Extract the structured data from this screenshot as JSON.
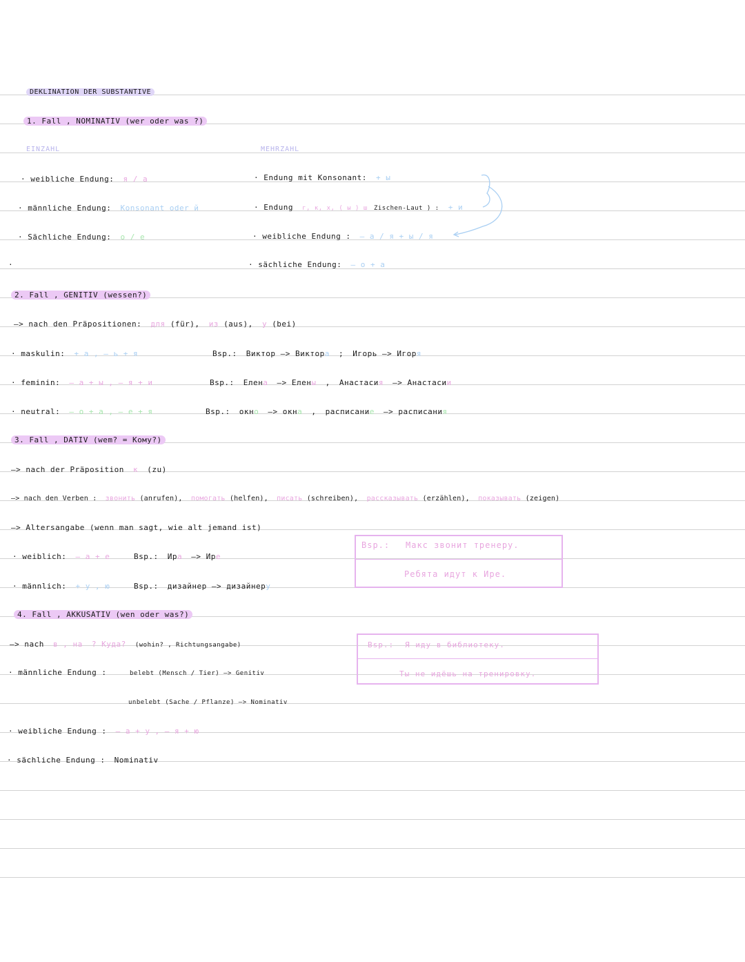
{
  "title": "DEKLINATION DER SUBSTANTIVE",
  "nominativ": {
    "heading": "1. Fall , NOMINATIV (wer oder was ?)",
    "einzahl_label": "EINZAHL",
    "mehrzahl_label": "MEHRZAHL",
    "sg_weiblich": "· weibliche Endung:",
    "sg_weiblich_val": "я / а",
    "sg_maennlich": "· männliche Endung:",
    "sg_maennlich_val": "Konsonant oder й",
    "sg_saechlich": "· Sächliche Endung:",
    "sg_saechlich_val": "о / е",
    "dot": "·",
    "pl_konsonant": "· Endung mit Konsonant:",
    "pl_konsonant_val": "+ ы",
    "pl_endung": "· Endung",
    "pl_endung_val": "г, к, х, ( ы ) ш",
    "pl_endung_note": "Zischen-Laut ) :",
    "pl_endung_val2": "+ и",
    "pl_weiblich": "· weibliche Endung :",
    "pl_weiblich_val": "– а / я + ы / я",
    "pl_saechlich": "· sächliche Endung:",
    "pl_saechlich_val": "– о + а"
  },
  "genitiv": {
    "heading": "2. Fall , GENITIV (wessen?)",
    "praep_label": "–> nach den Präpositionen:",
    "praep1": "для",
    "praep1_de": "(für),",
    "praep2": "из",
    "praep2_de": "(aus),",
    "praep3": "у",
    "praep3_de": "(bei)",
    "mask_label": "· maskulin:",
    "mask_val": "+ а , – ь + я",
    "mask_bsp": "Bsp.:",
    "mask_ex1a": "Виктор –> Виктор",
    "mask_ex1b": "а",
    "mask_semi": ";",
    "mask_ex2a": "Игорь –> Игор",
    "mask_ex2b": "я",
    "fem_label": "· feminin:",
    "fem_val": "– а + ы , – я + и",
    "fem_bsp": "Bsp.:",
    "fem_ex1a": "Елен",
    "fem_ex1b": "а",
    "fem_ex1c": "–> Елен",
    "fem_ex1d": "ы",
    "fem_comma": ",",
    "fem_ex2a": "Анастаси",
    "fem_ex2b": "я",
    "fem_ex2c": "–> Анастаси",
    "fem_ex2d": "и",
    "neut_label": "· neutral:",
    "neut_val": "– о + а , – е + я",
    "neut_bsp": "Bsp.:",
    "neut_ex1a": "окн",
    "neut_ex1b": "о",
    "neut_ex1c": "–> окн",
    "neut_ex1d": "а",
    "neut_comma": ",",
    "neut_ex2a": "расписани",
    "neut_ex2b": "е",
    "neut_ex2c": "–> расписани",
    "neut_ex2d": "я"
  },
  "dativ": {
    "heading": "3. Fall , DATIV (wem? = Кому?)",
    "praep_label": "–> nach der Präposition",
    "praep": "к",
    "praep_de": "(zu)",
    "verben_label": "–> nach den Verben :",
    "v1": "звонить",
    "v1_de": "(anrufen),",
    "v2": "помогать",
    "v2_de": "(helfen),",
    "v3": "писать",
    "v3_de": "(schreiben),",
    "v4": "рассказывать",
    "v4_de": "(erzählen),",
    "v5": "показывать",
    "v5_de": "(zeigen)",
    "alter": "–> Altersangabe (wenn man sagt, wie alt jemand ist)",
    "weib_label": "· weiblich:",
    "weib_val": "– а + е",
    "weib_bsp": "Bsp.:",
    "weib_ex_a": "Ир",
    "weib_ex_b": "а",
    "weib_ex_c": "–> Ир",
    "weib_ex_d": "е",
    "maenn_label": "· männlich:",
    "maenn_val": "+ у , ю",
    "maenn_bsp": "Bsp.:",
    "maenn_ex_a": "дизайнер –> дизайнер",
    "maenn_ex_b": "у",
    "box_bsp": "Bsp.:",
    "box_line1": "Макс звонит тренеру.",
    "box_line2": "Ребята идут к Ире."
  },
  "akkusativ": {
    "heading": "4. Fall , AKKUSATIV (wen oder was?)",
    "nach_label": "–> nach",
    "nach_val": "в , на",
    "nach_q": "? Куда?",
    "nach_de": "(wohin? , Richtungsangabe)",
    "maenn_label": "· männliche Endung :",
    "maenn_val1": "belebt (Mensch / Tier) –> Genitiv",
    "maenn_val2": "unbelebt (Sache / Pflanze) –> Nominativ",
    "weib_label": "· weibliche Endung :",
    "weib_val": "– а + у , – я + ю",
    "saech_label": "· sächliche Endung :",
    "saech_val": "Nominativ",
    "box_bsp": "Bsp.:",
    "box_line1": "Я иду в библиотеку.",
    "box_line2": "Ты не идёшь на тренировку."
  },
  "colors": {
    "pink": "#e8a6df",
    "blue": "#a9cff3",
    "green": "#a7e6ad",
    "highlight": "#ecc9f5",
    "rule": "#d2d2d2"
  }
}
